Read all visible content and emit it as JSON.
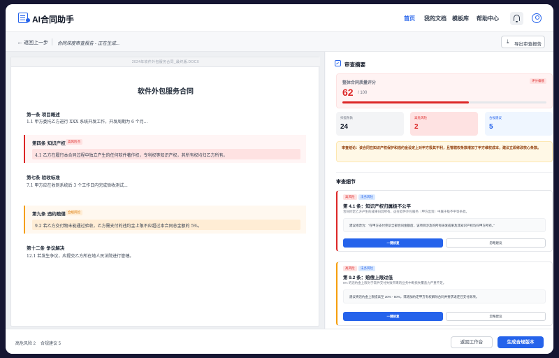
{
  "app": {
    "title": "AI合同助手"
  },
  "nav": {
    "items": [
      "首页",
      "我的文档",
      "模板库",
      "帮助中心"
    ],
    "active_index": 0
  },
  "icons": {
    "bell": "bell-icon",
    "user": "user-circle-icon",
    "back": "arrow-left-icon",
    "export": "download-icon",
    "summary": "checklist-icon",
    "logo": "document-logo-icon"
  },
  "subbar": {
    "back_label": "返回上一步",
    "status": "合同深度审查报告 - 正在生成...",
    "export_label": "导出审查报告"
  },
  "document": {
    "filename": "2024年软件外包服务合同_最终版.DOCX",
    "title": "软件外包服务合同",
    "sections": [
      {
        "heading": "第一条 项目概述",
        "body": "1.1 甲方委托乙方进行 XXX 系统开发工作，开发周期为 6 个月..."
      },
      {
        "heading": "第四条 知识产权",
        "tag": "高风险点",
        "body": "4.1 乙方在履行本合同过程中独立产生的任何软件著作权，专利权等知识产权，其所有权均归乙方所有。"
      },
      {
        "heading": "第七条 验收标准",
        "body": "7.1 甲方应在收到系统后 3 个工作日内完成验收测试..."
      },
      {
        "heading": "第九条 违约赔偿",
        "tag": "合规风险",
        "body": "9.2 若乙方交付物未能通过验收，乙方需支付的违约金上限不应超过本合同总金额的 5%。"
      },
      {
        "heading": "第十二条 争议解决",
        "body": "12.1 若发生争议，应提交乙方所在地人民法院进行管辖。"
      }
    ]
  },
  "review": {
    "title": "审查摘要",
    "score": {
      "label": "整体合同质量评分",
      "badge": "评分偏低",
      "value": "62",
      "max": "/ 100",
      "fraction": 0.62
    },
    "stats": [
      {
        "label": "扫描条款",
        "value": "24"
      },
      {
        "label": "高危风险",
        "value": "2"
      },
      {
        "label": "合规建议",
        "value": "5"
      }
    ],
    "conclusion": "审查结论：该合同在知识产权保护和违约金设定上对甲方极其不利，且管辖权条款增加了甲方维权成本，建议立即修改核心条款。",
    "detail_title": "审查细节",
    "cards": [
      {
        "tags": [
          "高风险",
          "法务风险"
        ],
        "title": "第 4.1 条：知识产权归属极不公平",
        "desc": "合同约定乙方产生的成果归其所有，这在软件外包服务（甲方出资）中属于极不平等条款。",
        "suggestion": "建议修改为：“在甲方支付完毕全部合同金额后，该项目涉及的所有研发成果及其知识产权均归甲方所有。”",
        "primary": "一键修复",
        "secondary": "忽略建议"
      },
      {
        "tags": [
          "高风险",
          "法务风险"
        ],
        "title": "第 9.2 条：赔偿上限过低",
        "desc": "5% 的违约金上限对于软件交付失败带来的业务中断损失覆盖力严重不足。",
        "suggestion": "建议将违约金上限提高至 30% - 50%，或增加约定甲方有权解除合同并要求退还已支付款项。",
        "primary": "一键修复",
        "secondary": "忽略建议"
      }
    ]
  },
  "footer": {
    "stats": [
      "高危风险 2",
      "合规建议 5"
    ],
    "return_label": "返回工作台",
    "generate_label": "生成合规版本"
  },
  "colors": {
    "accent": "#2563eb",
    "danger": "#dc2626",
    "warning": "#f59e0b"
  }
}
